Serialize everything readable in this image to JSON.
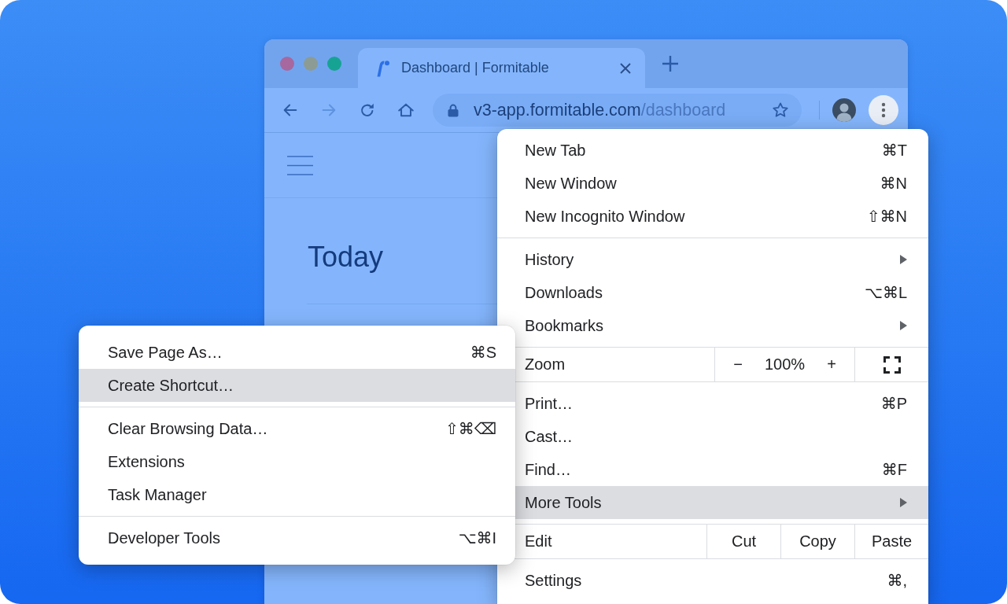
{
  "browser": {
    "tabs": [
      {
        "title": "Dashboard | Formitable",
        "selected": true
      }
    ],
    "toolbar": {
      "buttons": [
        {
          "kind": "back",
          "disabled": false
        },
        {
          "kind": "forward",
          "disabled": true
        },
        {
          "kind": "reload",
          "disabled": false
        },
        {
          "kind": "home",
          "disabled": false
        }
      ]
    },
    "address_bar": {
      "host": "v3-app.formitable.com",
      "path": "/dashboard"
    },
    "page": {
      "heading": "Today"
    }
  },
  "menu": {
    "groups": [
      [
        {
          "kind": "command",
          "label": "New Tab",
          "shortcut": "⌘T",
          "has_submenu": false,
          "selected": false
        },
        {
          "kind": "command",
          "label": "New Window",
          "shortcut": "⌘N",
          "has_submenu": false,
          "selected": false
        },
        {
          "kind": "command",
          "label": "New Incognito Window",
          "shortcut": "⇧⌘N",
          "has_submenu": false,
          "selected": false
        }
      ],
      [
        {
          "kind": "command",
          "label": "History",
          "has_submenu": true,
          "selected": false
        },
        {
          "kind": "command",
          "label": "Downloads",
          "shortcut": "⌥⌘L",
          "has_submenu": false,
          "selected": false
        },
        {
          "kind": "command",
          "label": "Bookmarks",
          "has_submenu": true,
          "selected": false
        }
      ],
      [
        {
          "kind": "zoom",
          "label": "Zoom",
          "decrease": "−",
          "value": "100%",
          "increase": "+"
        }
      ],
      [
        {
          "kind": "command",
          "label": "Print…",
          "shortcut": "⌘P",
          "has_submenu": false,
          "selected": false
        },
        {
          "kind": "command",
          "label": "Cast…",
          "has_submenu": false,
          "selected": false
        },
        {
          "kind": "command",
          "label": "Find…",
          "shortcut": "⌘F",
          "has_submenu": false,
          "selected": false
        },
        {
          "kind": "command",
          "label": "More Tools",
          "has_submenu": true,
          "selected": true
        }
      ],
      [
        {
          "kind": "edit",
          "label": "Edit",
          "actions": [
            "Cut",
            "Copy",
            "Paste"
          ]
        }
      ],
      [
        {
          "kind": "command",
          "label": "Settings",
          "shortcut": "⌘,",
          "has_submenu": false,
          "selected": false
        }
      ]
    ]
  },
  "submenu": {
    "groups": [
      [
        {
          "kind": "command",
          "label": "Save Page As…",
          "shortcut": "⌘S",
          "has_submenu": false,
          "selected": false
        },
        {
          "kind": "command",
          "label": "Create Shortcut…",
          "has_submenu": false,
          "selected": true
        }
      ],
      [
        {
          "kind": "command",
          "label": "Clear Browsing Data…",
          "shortcut": "⇧⌘⌫",
          "has_submenu": false,
          "selected": false
        },
        {
          "kind": "command",
          "label": "Extensions",
          "has_submenu": false,
          "selected": false
        },
        {
          "kind": "command",
          "label": "Task Manager",
          "has_submenu": false,
          "selected": false
        }
      ],
      [
        {
          "kind": "command",
          "label": "Developer Tools",
          "shortcut": "⌥⌘I",
          "has_submenu": false,
          "selected": false
        }
      ]
    ]
  }
}
